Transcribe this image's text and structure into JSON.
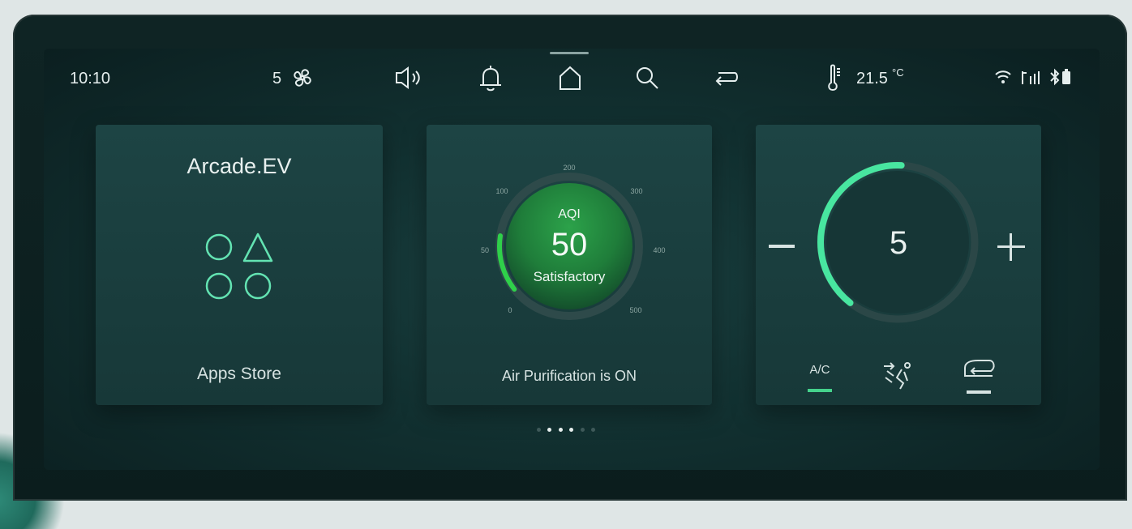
{
  "status_bar": {
    "time": "10:10",
    "fan_level": "5",
    "temperature": "21.5",
    "temperature_unit": "°C",
    "icons": [
      "fan-icon",
      "speaker-icon",
      "bell-icon",
      "home-icon",
      "search-icon",
      "return-icon",
      "thermometer-icon",
      "wifi-icon",
      "signal-icon",
      "bluetooth-icon",
      "battery-icon"
    ]
  },
  "apps_card": {
    "title": "Arcade.EV",
    "label": "Apps Store",
    "icons": [
      "circle-icon",
      "triangle-icon",
      "circle-icon",
      "circle-icon"
    ]
  },
  "aqi_card": {
    "heading": "AQI",
    "value": "50",
    "status": "Satisfactory",
    "scale_labels": [
      "0",
      "50",
      "100",
      "200",
      "300",
      "400",
      "500"
    ],
    "label": "Air Purification is ON"
  },
  "climate_card": {
    "value": "5",
    "minus_label": "—",
    "plus_label": "+",
    "level_fraction": 0.4,
    "modes": [
      "A/C",
      "seat-airflow-icon",
      "recirculation-icon"
    ]
  },
  "pagination": {
    "count": 5,
    "active": 2
  },
  "colors": {
    "accent": "#35d08e",
    "aqi_fill": "#2fa24a"
  }
}
